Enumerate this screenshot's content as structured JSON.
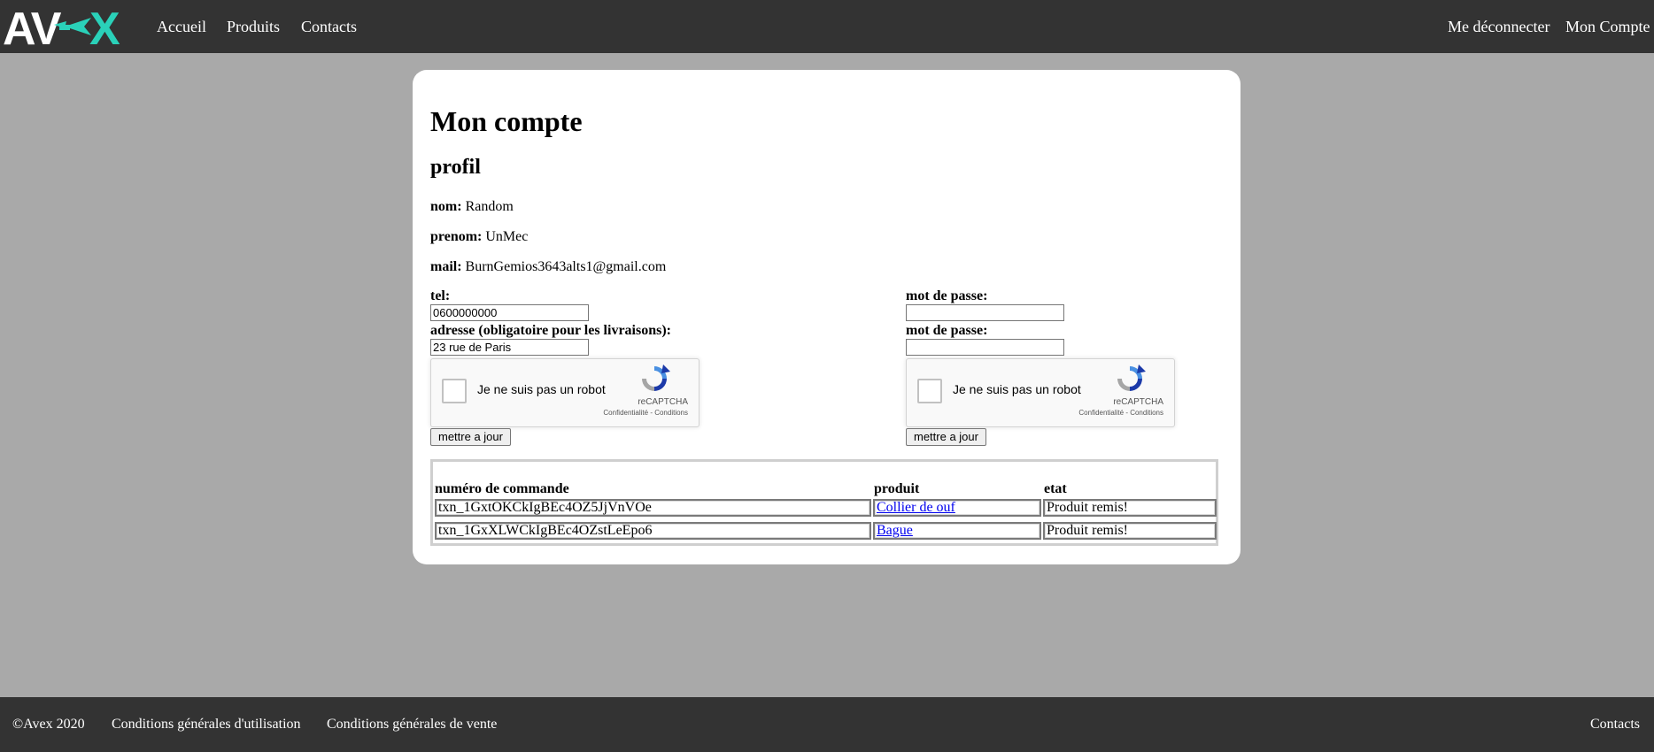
{
  "brand": {
    "logo_text": "AVEX"
  },
  "nav": {
    "left": [
      "Accueil",
      "Produits",
      "Contacts"
    ],
    "right": [
      "Me déconnecter",
      "Mon Compte"
    ]
  },
  "page": {
    "title": "Mon compte",
    "section": "profil"
  },
  "profile": {
    "nom_label": "nom:",
    "nom_value": "Random",
    "prenom_label": "prenom:",
    "prenom_value": "UnMec",
    "mail_label": "mail:",
    "mail_value": "BurnGemios3643alts1@gmail.com"
  },
  "form_left": {
    "tel_label": "tel:",
    "tel_value": "0600000000",
    "address_label": "adresse (obligatoire pour les livraisons):",
    "address_value": "23 rue de Paris",
    "submit_label": "mettre a jour"
  },
  "form_right": {
    "password_label": "mot de passe:",
    "password_value": "",
    "password_confirm_label": "mot de passe:",
    "password_confirm_value": "",
    "submit_label": "mettre a jour"
  },
  "captcha": {
    "text": "Je ne suis pas un robot",
    "brand": "reCAPTCHA",
    "links": "Confidentialité - Conditions"
  },
  "orders": {
    "columns": [
      "numéro de commande",
      "produit",
      "etat"
    ],
    "rows": [
      {
        "id": "txn_1GxtOKCkIgBEc4OZ5JjVnVOe",
        "product": "Collier de ouf",
        "status": "Produit remis!"
      },
      {
        "id": "txn_1GxXLWCkIgBEc4OZstLeEpo6",
        "product": "Bague",
        "status": "Produit remis!"
      }
    ]
  },
  "footer": {
    "copyright": "©Avex 2020",
    "cgu": "Conditions générales d'utilisation",
    "cgv": "Conditions générales de vente",
    "contacts": "Contacts"
  },
  "colors": {
    "bar": "#333333",
    "background": "#a9a9a9",
    "logo_accent": "#2ad1b9"
  }
}
